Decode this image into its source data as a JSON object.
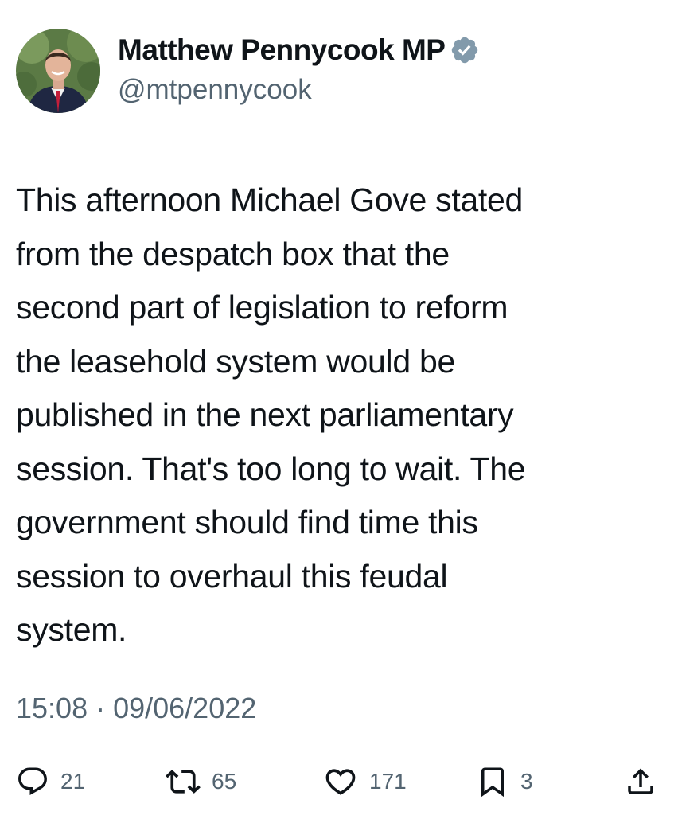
{
  "author": {
    "display_name": "Matthew Pennycook MP",
    "handle": "@mtpennycook",
    "verified": true,
    "verified_color": "#829aab"
  },
  "tweet": {
    "text": "This afternoon Michael Gove stated\nfrom the despatch box that the\nsecond part of legislation to reform\nthe leasehold system would be\npublished in the next parliamentary\nsession. That's too long to wait. The\ngovernment should find time this\nsession to overhaul this feudal\nsystem.",
    "timestamp": "15:08 · 09/06/2022"
  },
  "actions": {
    "replies": "21",
    "retweets": "65",
    "likes": "171",
    "bookmarks": "3"
  },
  "icons": {
    "reply": "reply-icon",
    "retweet": "retweet-icon",
    "like": "heart-icon",
    "bookmark": "bookmark-icon",
    "share": "share-icon",
    "verified": "verified-badge-icon"
  },
  "colors": {
    "text": "#0f1419",
    "secondary": "#536471",
    "background": "#ffffff"
  }
}
